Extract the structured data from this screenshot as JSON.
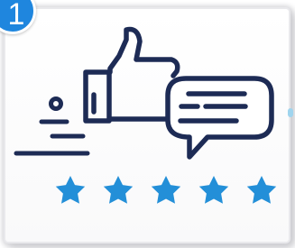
{
  "step_badge": {
    "number": "1"
  },
  "illustration": {
    "icons": [
      "thumbs-up-icon",
      "speech-bubble-icon",
      "star-icon"
    ],
    "rating": {
      "value": 5,
      "max": 5
    },
    "colors": {
      "outline": "#1d2b55",
      "stars": "#238fd8",
      "badge": "#1f86de"
    }
  }
}
